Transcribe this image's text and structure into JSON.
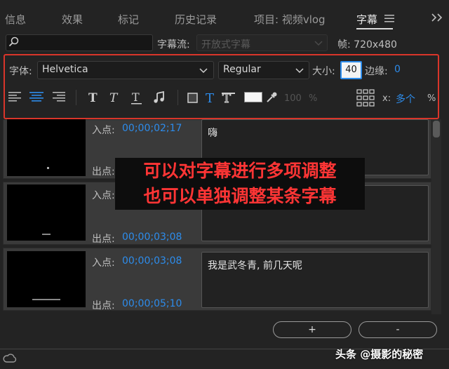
{
  "tabs": [
    {
      "label": "信息"
    },
    {
      "label": "效果"
    },
    {
      "label": "标记"
    },
    {
      "label": "历史记录"
    },
    {
      "label": "项目: 视频vlog"
    },
    {
      "label": "字幕"
    }
  ],
  "toolbar": {
    "search_placeholder": "",
    "stream_label": "字幕流:",
    "stream_value": "开放式字幕",
    "frame_label": "帧: 720x480"
  },
  "properties": {
    "font_label": "字体:",
    "font_value": "Helvetica",
    "style_value": "Regular",
    "size_label": "大小:",
    "size_value": "40",
    "edge_label": "边缘:",
    "edge_value": "0",
    "opacity_value": "100",
    "opacity_unit": "%",
    "x_label": "x:",
    "x_value": "多个",
    "x_unit": "%"
  },
  "captions": [
    {
      "in_label": "入点:",
      "in_tc": "00;00;02;17",
      "out_label": "出点:",
      "out_tc": "",
      "text": "嗨"
    },
    {
      "in_label": "入点:",
      "in_tc": "",
      "out_label": "出点:",
      "out_tc": "00;00;03;08",
      "text": ""
    },
    {
      "in_label": "入点:",
      "in_tc": "00;00;03;08",
      "out_label": "出点:",
      "out_tc": "00;00;05;10",
      "text": "我是武冬青, 前几天呢"
    }
  ],
  "overlay": {
    "line1": "可以对字幕进行多项调整",
    "line2": "也可以单独调整某条字幕"
  },
  "buttons": {
    "add": "+",
    "remove": "-"
  },
  "watermark": "头条 @摄影的秘密",
  "colors": {
    "accent_blue": "#2d8ceb",
    "highlight_red": "#d9352a",
    "overlay_text": "#ff3535"
  }
}
